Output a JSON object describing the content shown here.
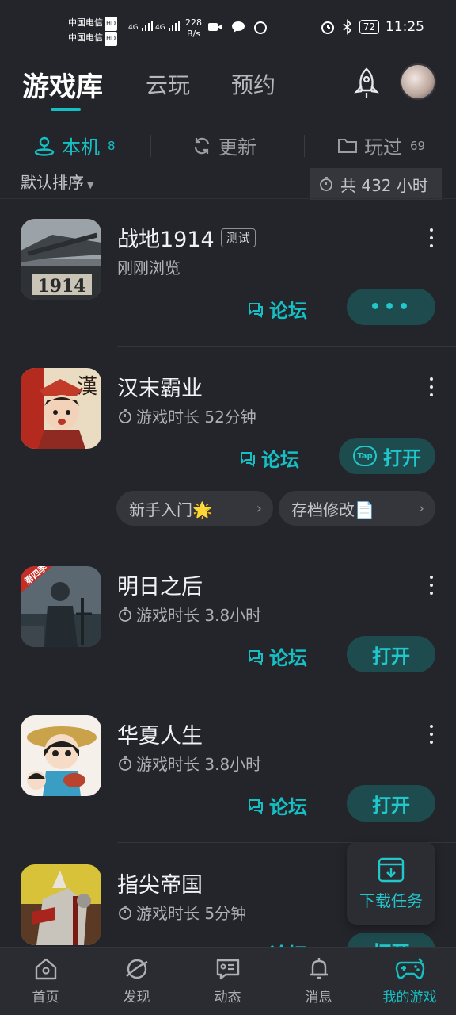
{
  "status_bar": {
    "carrier1": "中国电信",
    "carrier2": "中国电信",
    "hd": "HD",
    "sig1": "4G",
    "sig2": "4G",
    "net_speed_value": "228",
    "net_speed_unit": "B/s",
    "battery": "72",
    "time": "11:25"
  },
  "top_nav": {
    "tabs": [
      {
        "label": "游戏库"
      },
      {
        "label": "云玩"
      },
      {
        "label": "预约"
      }
    ]
  },
  "sub_tabs": [
    {
      "label": "本机",
      "count": "8",
      "icon": "device-icon"
    },
    {
      "label": "更新",
      "count": "",
      "icon": "refresh-icon"
    },
    {
      "label": "玩过",
      "count": "69",
      "icon": "folder-icon"
    }
  ],
  "sort": {
    "label": "默认排序",
    "total": "共 432 小时"
  },
  "games": [
    {
      "title": "战地1914",
      "tag": "测试",
      "subtitle": "刚刚浏览",
      "forum": "论坛",
      "action": "•••"
    },
    {
      "title": "汉末霸业",
      "subtitle": "游戏时长 52分钟",
      "forum": "论坛",
      "action": "打开",
      "chips": [
        {
          "label": "新手入门🌟"
        },
        {
          "label": "存档修改📄"
        }
      ]
    },
    {
      "title": "明日之后",
      "subtitle": "游戏时长 3.8小时",
      "forum": "论坛",
      "action": "打开",
      "icon_badge": "第四季"
    },
    {
      "title": "华夏人生",
      "subtitle": "游戏时长 3.8小时",
      "forum": "论坛",
      "action": "打开"
    },
    {
      "title": "指尖帝国",
      "subtitle": "游戏时长 5分钟",
      "forum": "论坛",
      "action": "打开"
    }
  ],
  "download_fab": {
    "label": "下载任务"
  },
  "bottom_nav": [
    {
      "label": "首页",
      "icon": "home-icon"
    },
    {
      "label": "发现",
      "icon": "planet-icon"
    },
    {
      "label": "动态",
      "icon": "feed-icon"
    },
    {
      "label": "消息",
      "icon": "bell-icon"
    },
    {
      "label": "我的游戏",
      "icon": "gamepad-icon"
    }
  ],
  "colors": {
    "accent": "#14c0c4",
    "background": "#24252b",
    "button_bg": "#1e4b4e"
  }
}
